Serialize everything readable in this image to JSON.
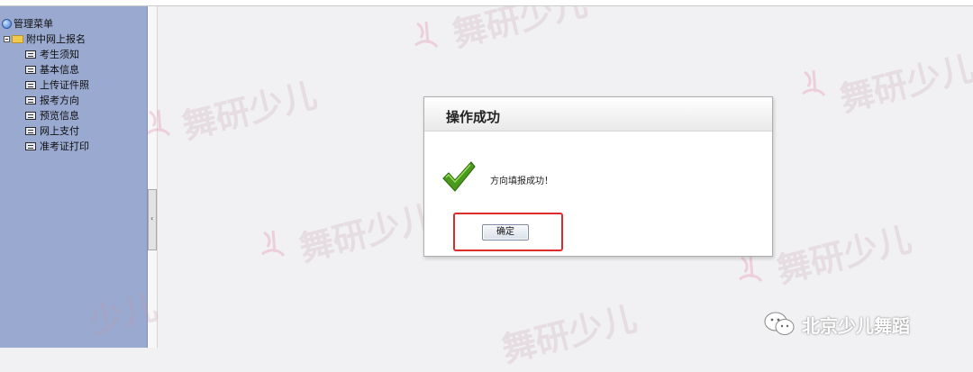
{
  "sidebar": {
    "root_label": "管理菜单",
    "folder_label": "附中网上报名",
    "items": [
      {
        "label": "考生须知"
      },
      {
        "label": "基本信息"
      },
      {
        "label": "上传证件照"
      },
      {
        "label": "报考方向"
      },
      {
        "label": "预览信息"
      },
      {
        "label": "网上支付"
      },
      {
        "label": "准考证打印"
      }
    ]
  },
  "splitter": {
    "arrow": "‹"
  },
  "dialog": {
    "title": "操作成功",
    "message": "方向填报成功！",
    "ok_label": "确定"
  },
  "watermark": {
    "text": "舞研少儿",
    "partial_text": "少儿"
  },
  "brand": {
    "name": "北京少儿舞蹈"
  },
  "colors": {
    "sidebar_bg": "#9aa9cf",
    "highlight": "#e02b2b",
    "check_green": "#4a9a1e"
  }
}
